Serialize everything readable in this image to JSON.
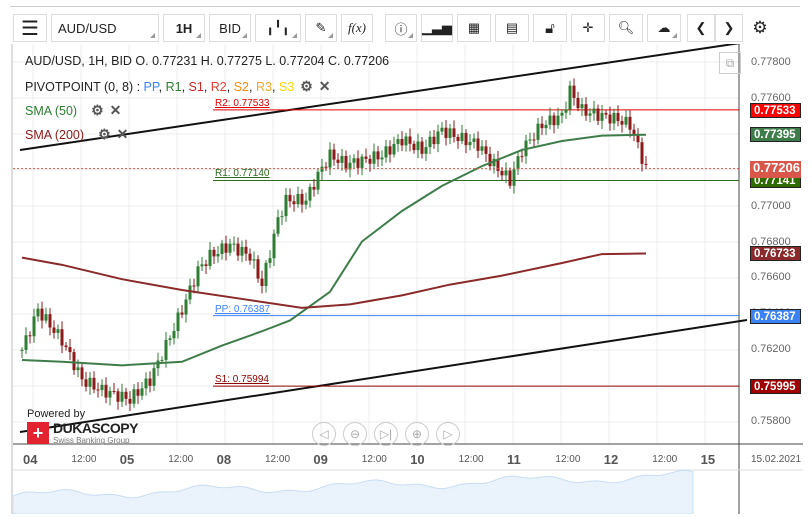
{
  "toolbar": {
    "symbol": "AUD/USD",
    "timeframe": "1H",
    "side": "BID",
    "fx_label": "f(x)"
  },
  "legend": {
    "ohlc": "AUD/USD, 1H, BID   O. 0.77231 H. 0.77275 L. 0.77204 C. 0.77206",
    "pivot_label": "PIVOTPOINT (0, 8)",
    "pivot_sep": " : ",
    "pivot_items": [
      {
        "t": "PP",
        "c": "#3b82f6"
      },
      {
        "t": "R1",
        "c": "#2e7d32"
      },
      {
        "t": "S1",
        "c": "#c62828"
      },
      {
        "t": "R2",
        "c": "#e53935"
      },
      {
        "t": "S2",
        "c": "#fb8c00"
      },
      {
        "t": "R3",
        "c": "#f9a825"
      },
      {
        "t": "S3",
        "c": "#ffd600"
      }
    ],
    "sma50": "SMA (50)",
    "sma200": "SMA (200)"
  },
  "levels": [
    {
      "name": "R2",
      "label": "R2: 0.77533",
      "value": 0.77533,
      "badge": "0.77533",
      "color": "#e00000",
      "badge_color": "#ff0000"
    },
    {
      "name": "R1",
      "label": "R1: 0.77140",
      "value": 0.7714,
      "badge": "0.77141",
      "color": "#2e6b1f",
      "badge_color": "#2e6b00"
    },
    {
      "name": "PP",
      "label": "PP: 0.76387",
      "value": 0.76387,
      "badge": "0.76387",
      "color": "#3b82f6",
      "badge_color": "#3b82f6"
    },
    {
      "name": "S1",
      "label": "S1: 0.75994",
      "value": 0.75994,
      "badge": "0.75995",
      "color": "#8b0000",
      "badge_color": "#a00000"
    }
  ],
  "price_badges": {
    "current": "0.77206",
    "sma50": "0.77395",
    "sma200": "0.76733"
  },
  "price_axis": [
    "0.77800",
    "0.77600",
    "0.77400",
    "0.77200",
    "0.77000",
    "0.76800",
    "0.76600",
    "0.76400",
    "0.76200",
    "0.76000",
    "0.75800"
  ],
  "time_axis": [
    {
      "t": "04",
      "d": 1
    },
    {
      "t": "12:00"
    },
    {
      "t": "05",
      "d": 1
    },
    {
      "t": "12:00"
    },
    {
      "t": "08",
      "d": 1
    },
    {
      "t": "12:00"
    },
    {
      "t": "09",
      "d": 1
    },
    {
      "t": "12:00"
    },
    {
      "t": "10",
      "d": 1
    },
    {
      "t": "12:00"
    },
    {
      "t": "11",
      "d": 1
    },
    {
      "t": "12:00"
    },
    {
      "t": "12",
      "d": 1
    },
    {
      "t": "12:00"
    },
    {
      "t": "15",
      "d": 1
    }
  ],
  "date_label": "15.02.2021",
  "branding": {
    "powered": "Powered by",
    "name": "DUKASCOPY",
    "sub": "Swiss Banking Group"
  },
  "chart_data": {
    "type": "candlestick",
    "ylim": [
      0.758,
      0.778
    ],
    "close_keypoints": [
      [
        0,
        0.76196
      ],
      [
        4,
        0.76418
      ],
      [
        10,
        0.7625
      ],
      [
        15,
        0.7603
      ],
      [
        20,
        0.7597
      ],
      [
        27,
        0.7592
      ],
      [
        32,
        0.7603
      ],
      [
        36,
        0.7622
      ],
      [
        40,
        0.7642
      ],
      [
        44,
        0.7664
      ],
      [
        47,
        0.7672
      ],
      [
        52,
        0.7678
      ],
      [
        57,
        0.7672
      ],
      [
        60,
        0.7656
      ],
      [
        64,
        0.7692
      ],
      [
        66,
        0.7703
      ],
      [
        71,
        0.7703
      ],
      [
        74,
        0.7717
      ],
      [
        77,
        0.7728
      ],
      [
        81,
        0.7723
      ],
      [
        85,
        0.7725
      ],
      [
        90,
        0.7728
      ],
      [
        95,
        0.7737
      ],
      [
        100,
        0.7731
      ],
      [
        105,
        0.7742
      ],
      [
        110,
        0.7737
      ],
      [
        114,
        0.7734
      ],
      [
        117,
        0.7725
      ],
      [
        122,
        0.7714
      ],
      [
        125,
        0.7731
      ],
      [
        130,
        0.7745
      ],
      [
        135,
        0.775
      ],
      [
        137,
        0.7764
      ],
      [
        140,
        0.7753
      ],
      [
        145,
        0.775
      ],
      [
        149,
        0.7748
      ],
      [
        152,
        0.7745
      ],
      [
        156,
        0.77206
      ]
    ],
    "sma50": [
      [
        0,
        0.7614
      ],
      [
        10,
        0.7613
      ],
      [
        25,
        0.7611
      ],
      [
        40,
        0.7613
      ],
      [
        50,
        0.7622
      ],
      [
        60,
        0.763
      ],
      [
        67,
        0.7636
      ],
      [
        77,
        0.7652
      ],
      [
        85,
        0.768
      ],
      [
        95,
        0.7697
      ],
      [
        105,
        0.7711
      ],
      [
        115,
        0.7722
      ],
      [
        125,
        0.7731
      ],
      [
        135,
        0.7736
      ],
      [
        145,
        0.7739
      ],
      [
        156,
        0.77395
      ]
    ],
    "sma200": [
      [
        0,
        0.7671
      ],
      [
        10,
        0.7667
      ],
      [
        25,
        0.7659
      ],
      [
        40,
        0.7653
      ],
      [
        55,
        0.7648
      ],
      [
        70,
        0.7643
      ],
      [
        82,
        0.7645
      ],
      [
        95,
        0.765
      ],
      [
        107,
        0.7656
      ],
      [
        120,
        0.7661
      ],
      [
        135,
        0.7668
      ],
      [
        145,
        0.7673
      ],
      [
        156,
        0.76733
      ]
    ]
  }
}
